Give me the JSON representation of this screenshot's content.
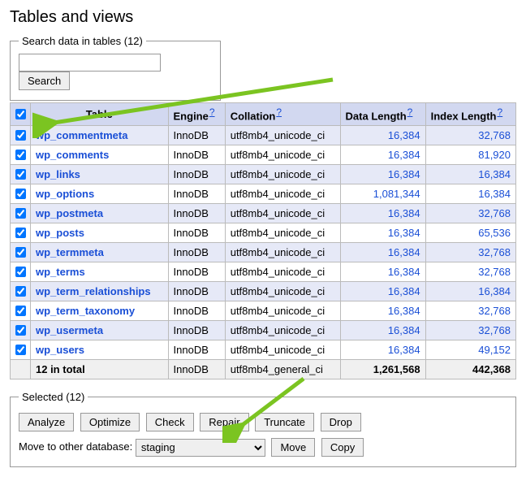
{
  "heading": "Tables and views",
  "search": {
    "legend": "Search data in tables (12)",
    "value": "",
    "button": "Search"
  },
  "columns": {
    "table": "Table",
    "engine": "Engine",
    "collation": "Collation",
    "data_length": "Data Length",
    "index_length": "Index Length",
    "help": "?"
  },
  "rows": [
    {
      "checked": true,
      "name": "wp_commentmeta",
      "engine": "InnoDB",
      "collation": "utf8mb4_unicode_ci",
      "data_length": "16,384",
      "index_length": "32,768"
    },
    {
      "checked": true,
      "name": "wp_comments",
      "engine": "InnoDB",
      "collation": "utf8mb4_unicode_ci",
      "data_length": "16,384",
      "index_length": "81,920"
    },
    {
      "checked": true,
      "name": "wp_links",
      "engine": "InnoDB",
      "collation": "utf8mb4_unicode_ci",
      "data_length": "16,384",
      "index_length": "16,384"
    },
    {
      "checked": true,
      "name": "wp_options",
      "engine": "InnoDB",
      "collation": "utf8mb4_unicode_ci",
      "data_length": "1,081,344",
      "index_length": "16,384"
    },
    {
      "checked": true,
      "name": "wp_postmeta",
      "engine": "InnoDB",
      "collation": "utf8mb4_unicode_ci",
      "data_length": "16,384",
      "index_length": "32,768"
    },
    {
      "checked": true,
      "name": "wp_posts",
      "engine": "InnoDB",
      "collation": "utf8mb4_unicode_ci",
      "data_length": "16,384",
      "index_length": "65,536"
    },
    {
      "checked": true,
      "name": "wp_termmeta",
      "engine": "InnoDB",
      "collation": "utf8mb4_unicode_ci",
      "data_length": "16,384",
      "index_length": "32,768"
    },
    {
      "checked": true,
      "name": "wp_terms",
      "engine": "InnoDB",
      "collation": "utf8mb4_unicode_ci",
      "data_length": "16,384",
      "index_length": "32,768"
    },
    {
      "checked": true,
      "name": "wp_term_relationships",
      "engine": "InnoDB",
      "collation": "utf8mb4_unicode_ci",
      "data_length": "16,384",
      "index_length": "16,384"
    },
    {
      "checked": true,
      "name": "wp_term_taxonomy",
      "engine": "InnoDB",
      "collation": "utf8mb4_unicode_ci",
      "data_length": "16,384",
      "index_length": "32,768"
    },
    {
      "checked": true,
      "name": "wp_usermeta",
      "engine": "InnoDB",
      "collation": "utf8mb4_unicode_ci",
      "data_length": "16,384",
      "index_length": "32,768"
    },
    {
      "checked": true,
      "name": "wp_users",
      "engine": "InnoDB",
      "collation": "utf8mb4_unicode_ci",
      "data_length": "16,384",
      "index_length": "49,152"
    }
  ],
  "total": {
    "label": "12 in total",
    "engine": "InnoDB",
    "collation": "utf8mb4_general_ci",
    "data_length": "1,261,568",
    "index_length": "442,368"
  },
  "selected": {
    "legend": "Selected (12)",
    "analyze": "Analyze",
    "optimize": "Optimize",
    "check": "Check",
    "repair": "Repair",
    "truncate": "Truncate",
    "drop": "Drop",
    "move_label": "Move to other database:",
    "move_target": "staging",
    "move": "Move",
    "copy": "Copy"
  }
}
